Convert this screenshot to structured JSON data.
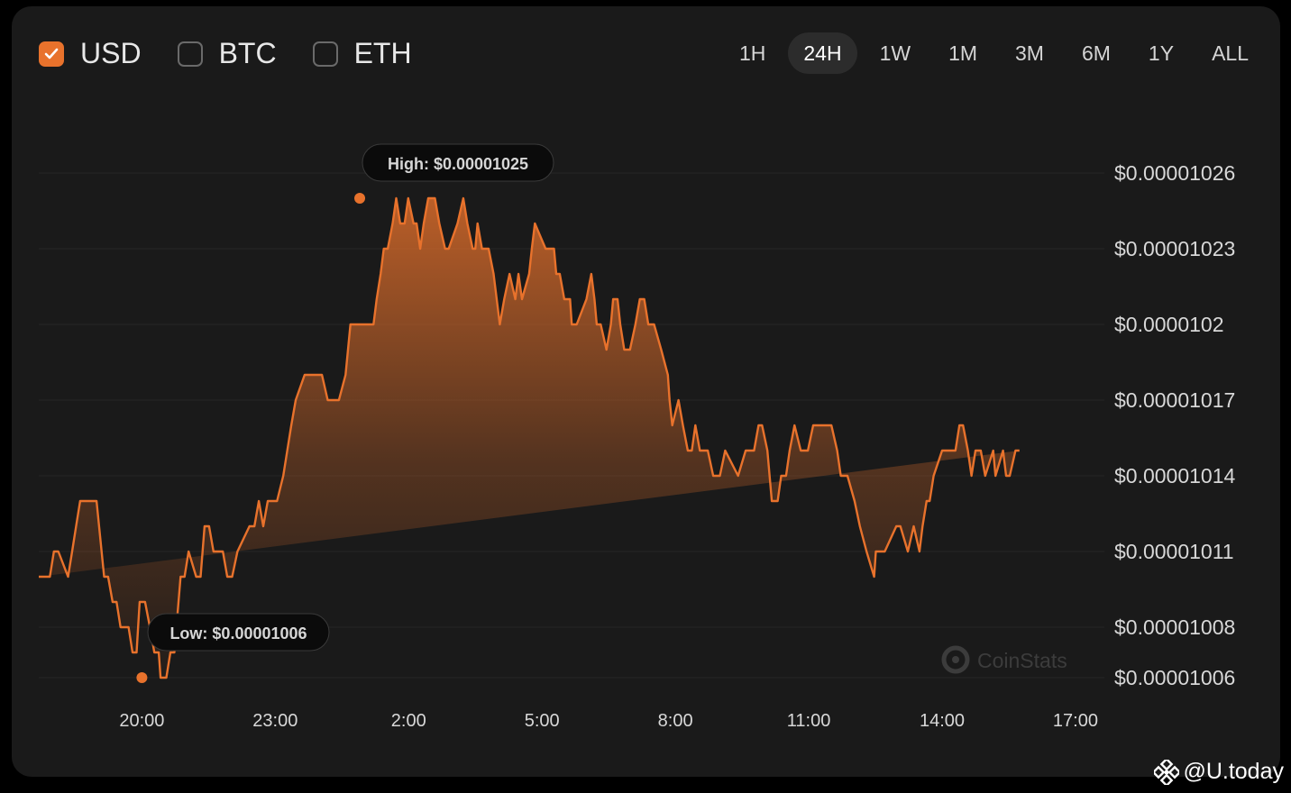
{
  "currencies": [
    {
      "label": "USD",
      "checked": true
    },
    {
      "label": "BTC",
      "checked": false
    },
    {
      "label": "ETH",
      "checked": false
    }
  ],
  "ranges": [
    {
      "label": "1H",
      "active": false
    },
    {
      "label": "24H",
      "active": true
    },
    {
      "label": "1W",
      "active": false
    },
    {
      "label": "1M",
      "active": false
    },
    {
      "label": "3M",
      "active": false
    },
    {
      "label": "6M",
      "active": false
    },
    {
      "label": "1Y",
      "active": false
    },
    {
      "label": "ALL",
      "active": false
    }
  ],
  "watermark": "CoinStats",
  "footer": {
    "at": "@",
    "brand": "U.today"
  },
  "colors": {
    "accent": "#e8722c",
    "card": "#1a1a1a",
    "background": "#000000"
  },
  "chart_data": {
    "type": "area",
    "title": "",
    "xlabel": "",
    "ylabel": "",
    "y_tick_values": [
      1.006e-05,
      1.008e-05,
      1.011e-05,
      1.014e-05,
      1.017e-05,
      1.02e-05,
      1.023e-05,
      1.026e-05
    ],
    "y_tick_labels": [
      "$0.00001006",
      "$0.00001008",
      "$0.00001011",
      "$0.00001014",
      "$0.00001017",
      "$0.0000102",
      "$0.00001023",
      "$0.00001026"
    ],
    "x_tick_hours": [
      20,
      23,
      26,
      29,
      32,
      35,
      38,
      41
    ],
    "x_tick_labels": [
      "20:00",
      "23:00",
      "2:00",
      "5:00",
      "8:00",
      "11:00",
      "14:00",
      "17:00"
    ],
    "x_range_hours": [
      17.68,
      41.65
    ],
    "ylim": [
      1.0055e-05,
      1.028e-05
    ],
    "grid": true,
    "series": [
      {
        "x_hours": [
          17.68,
          17.93,
          18.02,
          18.12,
          18.34,
          18.43,
          18.52,
          18.61,
          18.7,
          18.98,
          19.15,
          19.24,
          19.34,
          19.43,
          19.52,
          19.7,
          19.79,
          19.88,
          19.95,
          20.01,
          20.07,
          20.18,
          20.28,
          20.38,
          20.42,
          20.49,
          20.55,
          20.64,
          20.73,
          20.87,
          20.96,
          21.05,
          21.22,
          21.32,
          21.41,
          21.51,
          21.61,
          21.72,
          21.82,
          21.92,
          22.03,
          22.15,
          22.42,
          22.53,
          22.63,
          22.73,
          22.83,
          22.93,
          23.04,
          23.18,
          23.36,
          23.46,
          23.66,
          23.88,
          24.05,
          24.18,
          24.26,
          24.43,
          24.58,
          24.69,
          24.8,
          24.87,
          24.98,
          25.08,
          25.21,
          25.28,
          25.37,
          25.44,
          25.53,
          25.64,
          25.72,
          25.81,
          25.91,
          25.99,
          26.11,
          26.18,
          26.26,
          26.34,
          26.44,
          26.52,
          26.59,
          26.69,
          26.82,
          26.9,
          27.1,
          27.23,
          27.32,
          27.44,
          27.5,
          27.55,
          27.65,
          27.72,
          27.8,
          27.91,
          28.05,
          28.15,
          28.27,
          28.4,
          28.47,
          28.55,
          28.71,
          28.77,
          28.84,
          29.08,
          29.27,
          29.32,
          29.4,
          29.5,
          29.63,
          29.67,
          29.78,
          30.0,
          30.11,
          30.18,
          30.23,
          30.32,
          30.45,
          30.55,
          30.6,
          30.7,
          30.76,
          30.85,
          30.98,
          31.1,
          31.2,
          31.3,
          31.39,
          31.52,
          31.68,
          31.83,
          31.87,
          31.93,
          32.07,
          32.17,
          32.28,
          32.37,
          32.45,
          32.55,
          32.65,
          32.73,
          32.85,
          33.0,
          33.12,
          33.41,
          33.58,
          33.68,
          33.77,
          33.87,
          33.95,
          34.07,
          34.17,
          34.3,
          34.38,
          34.49,
          34.57,
          34.68,
          34.82,
          34.98,
          35.1,
          35.38,
          35.51,
          35.64,
          35.72,
          35.82,
          35.87,
          36.03,
          36.15,
          36.3,
          36.47,
          36.51,
          36.71,
          36.97,
          37.06,
          37.23,
          37.36,
          37.49,
          37.56,
          37.65,
          37.72,
          37.81,
          38.0,
          38.19,
          38.3,
          38.39,
          38.47,
          38.58,
          38.66,
          38.75,
          38.87,
          38.97,
          39.15,
          39.2,
          39.37,
          39.44,
          39.52,
          39.65,
          39.74,
          39.83,
          40.05,
          40.28,
          40.37,
          40.47,
          40.55,
          40.63,
          40.73,
          40.8,
          40.87,
          40.94,
          41.07,
          41.16,
          41.25,
          41.33,
          41.41,
          41.49,
          41.56,
          41.65
        ],
        "values": [
          1.01e-05,
          1.01e-05,
          1.011e-05,
          1.011e-05,
          1.01e-05,
          1.011e-05,
          1.012e-05,
          1.013e-05,
          1.013e-05,
          1.013e-05,
          1.01e-05,
          1.01e-05,
          1.009e-05,
          1.009e-05,
          1.008e-05,
          1.008e-05,
          1.007e-05,
          1.007e-05,
          1.009e-05,
          1.009e-05,
          1.009e-05,
          1.008e-05,
          1.007e-05,
          1.007e-05,
          1.006e-05,
          1.006e-05,
          1.006e-05,
          1.007e-05,
          1.007e-05,
          1.01e-05,
          1.01e-05,
          1.011e-05,
          1.01e-05,
          1.01e-05,
          1.012e-05,
          1.012e-05,
          1.011e-05,
          1.011e-05,
          1.011e-05,
          1.01e-05,
          1.01e-05,
          1.011e-05,
          1.012e-05,
          1.012e-05,
          1.013e-05,
          1.012e-05,
          1.013e-05,
          1.013e-05,
          1.013e-05,
          1.014e-05,
          1.016e-05,
          1.017e-05,
          1.018e-05,
          1.018e-05,
          1.018e-05,
          1.017e-05,
          1.017e-05,
          1.017e-05,
          1.018e-05,
          1.02e-05,
          1.02e-05,
          1.02e-05,
          1.02e-05,
          1.02e-05,
          1.02e-05,
          1.021e-05,
          1.022e-05,
          1.023e-05,
          1.023e-05,
          1.024e-05,
          1.025e-05,
          1.024e-05,
          1.024e-05,
          1.025e-05,
          1.024e-05,
          1.024e-05,
          1.023e-05,
          1.024e-05,
          1.025e-05,
          1.025e-05,
          1.025e-05,
          1.024e-05,
          1.023e-05,
          1.023e-05,
          1.024e-05,
          1.025e-05,
          1.024e-05,
          1.023e-05,
          1.023e-05,
          1.024e-05,
          1.023e-05,
          1.023e-05,
          1.023e-05,
          1.022e-05,
          1.02e-05,
          1.021e-05,
          1.022e-05,
          1.021e-05,
          1.022e-05,
          1.021e-05,
          1.022e-05,
          1.023e-05,
          1.024e-05,
          1.023e-05,
          1.023e-05,
          1.022e-05,
          1.022e-05,
          1.021e-05,
          1.021e-05,
          1.02e-05,
          1.02e-05,
          1.021e-05,
          1.022e-05,
          1.021e-05,
          1.02e-05,
          1.02e-05,
          1.019e-05,
          1.02e-05,
          1.021e-05,
          1.021e-05,
          1.02e-05,
          1.019e-05,
          1.019e-05,
          1.02e-05,
          1.021e-05,
          1.021e-05,
          1.02e-05,
          1.02e-05,
          1.019e-05,
          1.018e-05,
          1.017e-05,
          1.016e-05,
          1.017e-05,
          1.016e-05,
          1.015e-05,
          1.015e-05,
          1.016e-05,
          1.015e-05,
          1.015e-05,
          1.015e-05,
          1.014e-05,
          1.014e-05,
          1.015e-05,
          1.014e-05,
          1.015e-05,
          1.015e-05,
          1.015e-05,
          1.016e-05,
          1.016e-05,
          1.015e-05,
          1.013e-05,
          1.013e-05,
          1.014e-05,
          1.014e-05,
          1.015e-05,
          1.016e-05,
          1.015e-05,
          1.015e-05,
          1.016e-05,
          1.016e-05,
          1.016e-05,
          1.015e-05,
          1.014e-05,
          1.014e-05,
          1.014e-05,
          1.013e-05,
          1.012e-05,
          1.011e-05,
          1.01e-05,
          1.011e-05,
          1.011e-05,
          1.012e-05,
          1.012e-05,
          1.011e-05,
          1.012e-05,
          1.011e-05,
          1.012e-05,
          1.013e-05,
          1.013e-05,
          1.014e-05,
          1.015e-05,
          1.015e-05,
          1.015e-05,
          1.016e-05,
          1.016e-05,
          1.015e-05,
          1.014e-05,
          1.015e-05,
          1.015e-05,
          1.014e-05,
          1.015e-05,
          1.014e-05,
          1.015e-05,
          1.014e-05,
          1.014e-05,
          1.015e-05,
          1.015e-05
        ],
        "color": "#e8722c"
      }
    ],
    "annotations": [
      {
        "label": "High: $0.00001025",
        "x_hour": 24.9,
        "value": 1.025e-05
      },
      {
        "label": "Low: $0.00001006",
        "x_hour": 20.0,
        "value": 1.006e-05
      }
    ]
  }
}
